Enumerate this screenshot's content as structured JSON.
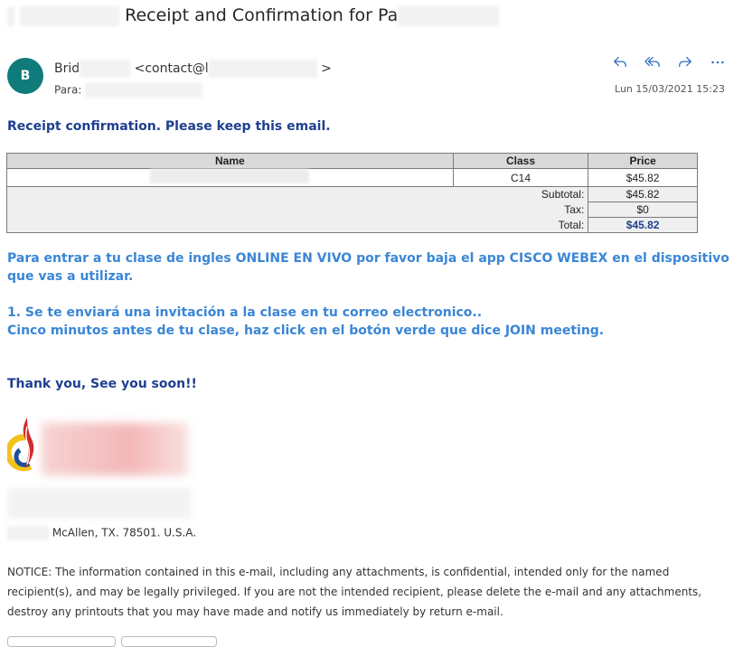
{
  "email": {
    "subject": "Receipt and Confirmation for Pa",
    "avatar_initial": "B",
    "sender_name": "Brid",
    "sender_email": "<contact@l",
    "sender_email_end": ">",
    "to_label": "Para:",
    "date": "Lun 15/03/2021 15:23"
  },
  "actions": [
    {
      "name": "reply-icon"
    },
    {
      "name": "reply-all-icon"
    },
    {
      "name": "forward-icon"
    },
    {
      "name": "more-icon"
    }
  ],
  "receipt": {
    "heading": "Receipt confirmation. Please keep this email.",
    "columns": [
      "Name",
      "Class",
      "Price"
    ],
    "item": {
      "class": "C14",
      "price": "$45.82"
    },
    "subtotal_label": "Subtotal:",
    "subtotal": "$45.82",
    "tax_label": "Tax:",
    "tax": "$0",
    "total_label": "Total:",
    "total": "$45.82"
  },
  "instructions": {
    "p1": "Para entrar a tu clase de ingles ONLINE EN VIVO por favor baja el app CISCO WEBEX en el dispositivo que vas a utilizar.",
    "p2a": "1. Se te enviará una invitación a la clase en tu correo electronico..",
    "p2b": "Cinco minutos antes de tu clase, haz click en el botón verde que dice JOIN meeting."
  },
  "closing": "Thank you, See you soon!!",
  "footer": {
    "address": "McAllen, TX. 78501. U.S.A.",
    "notice": "NOTICE: The information contained in this e-mail, including any attachments, is confidential, intended only for the named recipient(s), and may be legally privileged. If you are not the intended recipient, please delete the e-mail and any attachments, destroy any printouts that you may have made and notify us immediately by return e-mail."
  },
  "colors": {
    "accent": "#2b6cc4",
    "heading_blue": "#1f3f8f",
    "instruction_blue": "#3a86d6",
    "avatar_bg": "#0f7b7b"
  }
}
